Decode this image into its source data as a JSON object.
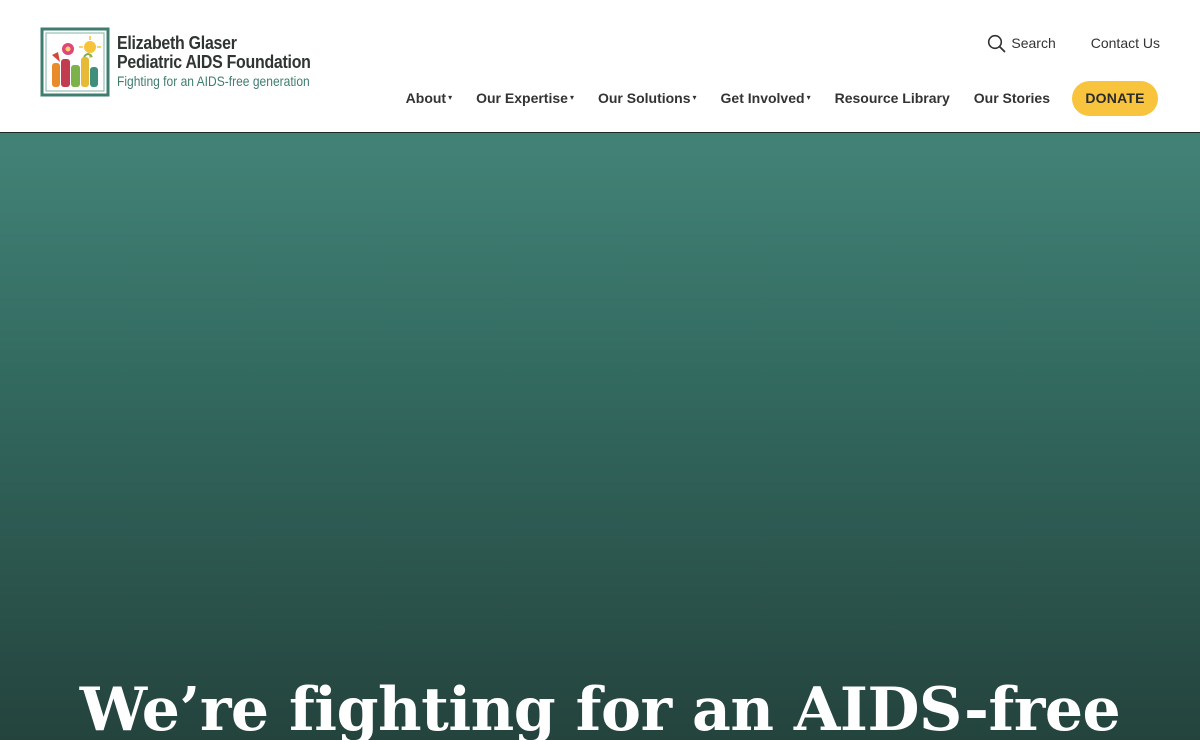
{
  "header": {
    "logo": {
      "line1": "Elizabeth Glaser",
      "line2": "Pediatric AIDS Foundation",
      "tagline": "Fighting for an AIDS-free generation"
    },
    "utility": {
      "search_label": "Search",
      "search_icon": "search-icon",
      "contact_label": "Contact Us"
    },
    "nav": {
      "items": [
        {
          "label": "About",
          "dropdown": true
        },
        {
          "label": "Our Expertise",
          "dropdown": true
        },
        {
          "label": "Our Solutions",
          "dropdown": true
        },
        {
          "label": "Get Involved",
          "dropdown": true
        },
        {
          "label": "Resource Library",
          "dropdown": false
        },
        {
          "label": "Our Stories",
          "dropdown": false
        }
      ],
      "caret": "▾",
      "donate_label": "DONATE"
    }
  },
  "hero": {
    "title": "We’re fighting for an AIDS-free"
  },
  "colors": {
    "brand_green": "#3f7d6f",
    "donate_yellow": "#f8c33d",
    "hero_top": "#438377",
    "hero_bottom": "#24433d",
    "text_dark": "#333333"
  }
}
